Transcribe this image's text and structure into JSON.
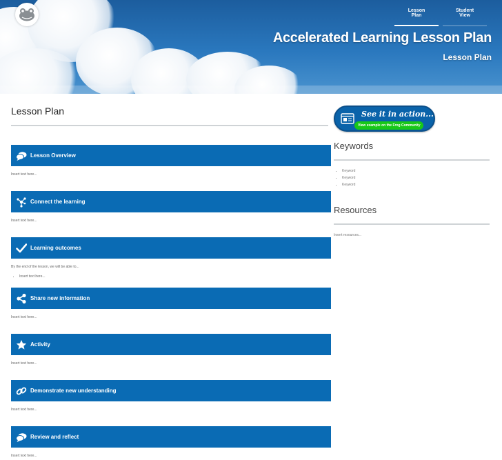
{
  "header": {
    "title": "Accelerated Learning Lesson Plan",
    "subtitle": "Lesson Plan",
    "nav": [
      {
        "label": "Lesson Plan",
        "active": true
      },
      {
        "label": "Student View",
        "active": false
      }
    ],
    "logo_icon": "frog-logo-icon"
  },
  "main": {
    "heading": "Lesson Plan",
    "sections": [
      {
        "title": "Lesson Overview",
        "icon": "speech-bubbles-icon",
        "body": [
          "Insert text here..."
        ]
      },
      {
        "title": "Connect the learning",
        "icon": "network-nodes-icon",
        "body": [
          "Insert text here..."
        ]
      },
      {
        "title": "Learning outcomes",
        "icon": "checkmark-icon",
        "intro": "By the end of the lesson, we will be able to...",
        "bullets": [
          "Insert text here..."
        ]
      },
      {
        "title": "Share new information",
        "icon": "share-icon",
        "body": [
          "Insert text here..."
        ]
      },
      {
        "title": "Activity",
        "icon": "star-icon",
        "body": [
          "Insert text here..."
        ]
      },
      {
        "title": "Demonstrate new understanding",
        "icon": "chain-link-icon",
        "body": [
          "Insert text here..."
        ]
      },
      {
        "title": "Review and reflect",
        "icon": "speech-bubbles-icon",
        "body": [
          "Insert text here..."
        ]
      }
    ]
  },
  "sidebar": {
    "cta": {
      "title": "See it in action...",
      "subtitle": "View example on the Frog Community"
    },
    "keywords_heading": "Keywords",
    "keywords": [
      "Keyword",
      "Keyword",
      "Keyword"
    ],
    "resources_heading": "Resources",
    "resources_text": "Insert resources..."
  },
  "colors": {
    "section_bar": "#0a6bb4",
    "cta_green": "#17c817",
    "banner": "#2a78be"
  }
}
